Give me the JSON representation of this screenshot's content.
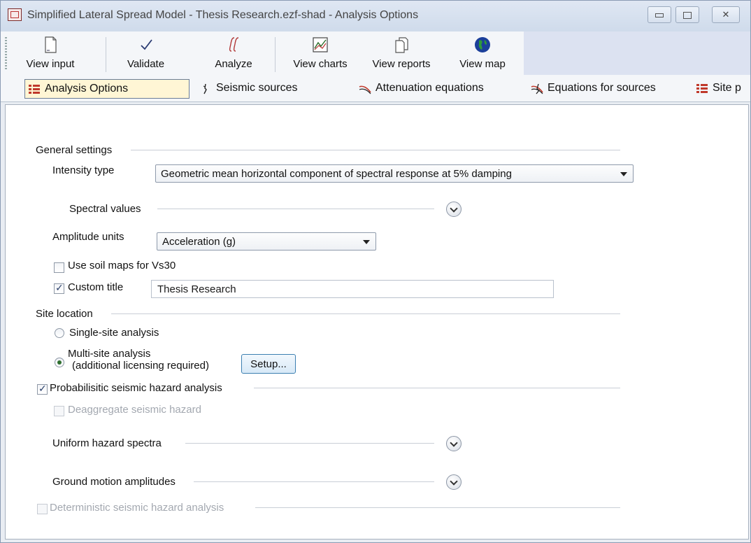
{
  "window": {
    "title": "Simplified Lateral Spread Model - Thesis Research.ezf-shad - Analysis Options",
    "controls": [
      "minimize",
      "restore",
      "close"
    ]
  },
  "toolbar": {
    "buttons": [
      {
        "label": "View input",
        "icon": "document-icon"
      },
      {
        "label": "Validate",
        "icon": "checkmark-icon"
      },
      {
        "label": "Analyze",
        "icon": "integral-icon"
      },
      {
        "label": "View charts",
        "icon": "chart-icon"
      },
      {
        "label": "View reports",
        "icon": "reports-icon"
      },
      {
        "label": "View map",
        "icon": "globe-icon"
      }
    ]
  },
  "tabs": [
    {
      "label": "Analysis Options",
      "icon": "list-icon",
      "active": true
    },
    {
      "label": "Seismic sources",
      "icon": "fault-icon",
      "active": false
    },
    {
      "label": "Attenuation equations",
      "icon": "attenuation-icon",
      "active": false
    },
    {
      "label": "Equations for sources",
      "icon": "equations-icon",
      "active": false
    },
    {
      "label": "Site p",
      "icon": "list-icon",
      "active": false
    }
  ],
  "general_settings": {
    "heading": "General settings",
    "intensity_type_label": "Intensity type",
    "intensity_type_value": "Geometric mean horizontal component of spectral response at 5% damping",
    "spectral_values_label": "Spectral values",
    "amplitude_units_label": "Amplitude units",
    "amplitude_units_value": "Acceleration (g)",
    "use_soil_maps_label": "Use soil maps for Vs30",
    "use_soil_maps_checked": false,
    "custom_title_label": "Custom title",
    "custom_title_checked": true,
    "custom_title_value": "Thesis Research"
  },
  "site_location": {
    "heading": "Site location",
    "single_site_label": "Single-site analysis",
    "multi_site_label_line1": "Multi-site analysis",
    "multi_site_label_line2": "(additional licensing required)",
    "selected": "multi",
    "setup_button": "Setup..."
  },
  "psha": {
    "label": "Probabilisitic seismic hazard analysis",
    "checked": true,
    "deaggregate_label": "Deaggregate seismic hazard",
    "deaggregate_enabled": false,
    "uniform_hazard_label": "Uniform hazard spectra",
    "ground_motion_label": "Ground motion amplitudes"
  },
  "dsha": {
    "label": "Deterministic seismic hazard analysis",
    "enabled": false
  },
  "colors": {
    "active_tab_bg": "#fff6d5",
    "toolbar_fill": "#dce2f1",
    "button_border": "#3c7fb1"
  }
}
